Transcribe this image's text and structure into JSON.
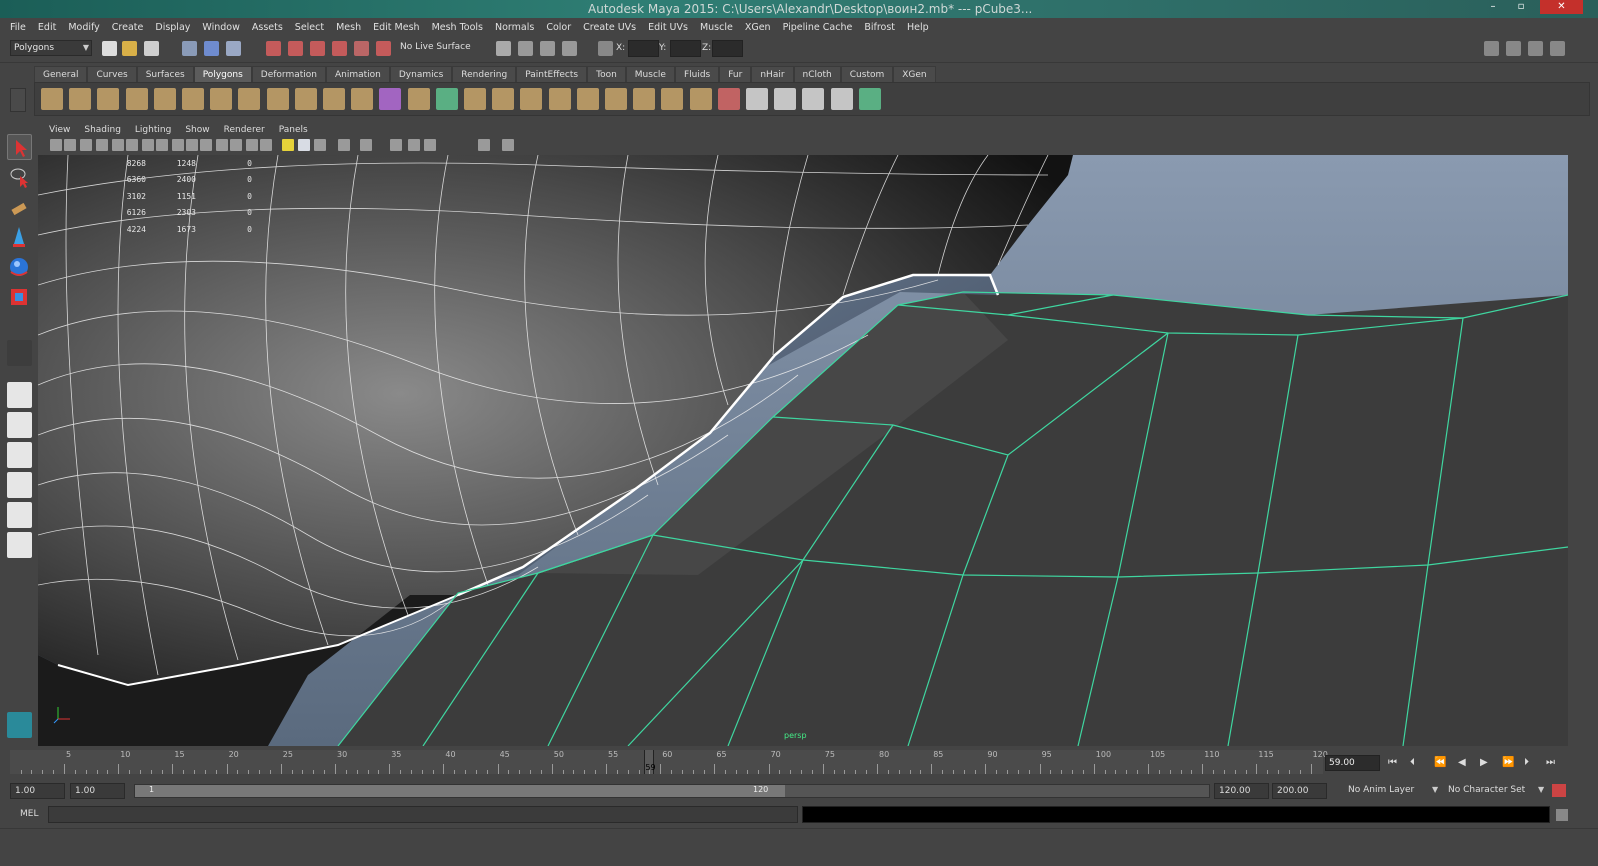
{
  "window": {
    "title": "Autodesk Maya 2015: C:\\Users\\Alexandr\\Desktop\\воин2.mb*   ---   pCube3..."
  },
  "menubar": {
    "items": [
      "File",
      "Edit",
      "Modify",
      "Create",
      "Display",
      "Window",
      "Assets",
      "Select",
      "Mesh",
      "Edit Mesh",
      "Mesh Tools",
      "Normals",
      "Color",
      "Create UVs",
      "Edit UVs",
      "Muscle",
      "XGen",
      "Pipeline Cache",
      "Bifrost",
      "Help"
    ]
  },
  "statusline": {
    "mode": "Polygons",
    "live_surface": "No Live Surface",
    "x_label": "X:",
    "y_label": "Y:",
    "z_label": "Z:"
  },
  "shelf": {
    "tabs": [
      "General",
      "Curves",
      "Surfaces",
      "Polygons",
      "Deformation",
      "Animation",
      "Dynamics",
      "Rendering",
      "PaintEffects",
      "Toon",
      "Muscle",
      "Fluids",
      "Fur",
      "nHair",
      "nCloth",
      "Custom",
      "XGen"
    ],
    "active_tab": "Polygons"
  },
  "panel": {
    "menus": [
      "View",
      "Shading",
      "Lighting",
      "Show",
      "Renderer",
      "Panels"
    ],
    "camera": "persp"
  },
  "hud": {
    "col1": [
      "8268",
      "6360",
      "3102",
      "6126",
      "4224"
    ],
    "col2": [
      "1248",
      "2400",
      "1151",
      "2303",
      "1673"
    ],
    "col3": [
      "0",
      "0",
      "0",
      "0",
      "0"
    ]
  },
  "timeslider": {
    "ticks": [
      "5",
      "10",
      "15",
      "20",
      "25",
      "30",
      "35",
      "40",
      "45",
      "50",
      "55",
      "60",
      "65",
      "70",
      "75",
      "80",
      "85",
      "90",
      "95",
      "100",
      "105",
      "110",
      "115",
      "120"
    ],
    "current_frame_label": "59",
    "current_frame_field": "59.00"
  },
  "range": {
    "start_time": "1.00",
    "playback_start": "1.00",
    "range_start_label": "1",
    "range_end_label": "120",
    "playback_end": "120.00",
    "end_time": "200.00",
    "anim_layer": "No Anim Layer",
    "character_set": "No Character Set"
  },
  "commandline": {
    "label": "MEL"
  },
  "colors": {
    "accent_green": "#3fd6a0",
    "viewport_sky": "#6d7f96",
    "mesh_dark": "#3b3b3b"
  }
}
